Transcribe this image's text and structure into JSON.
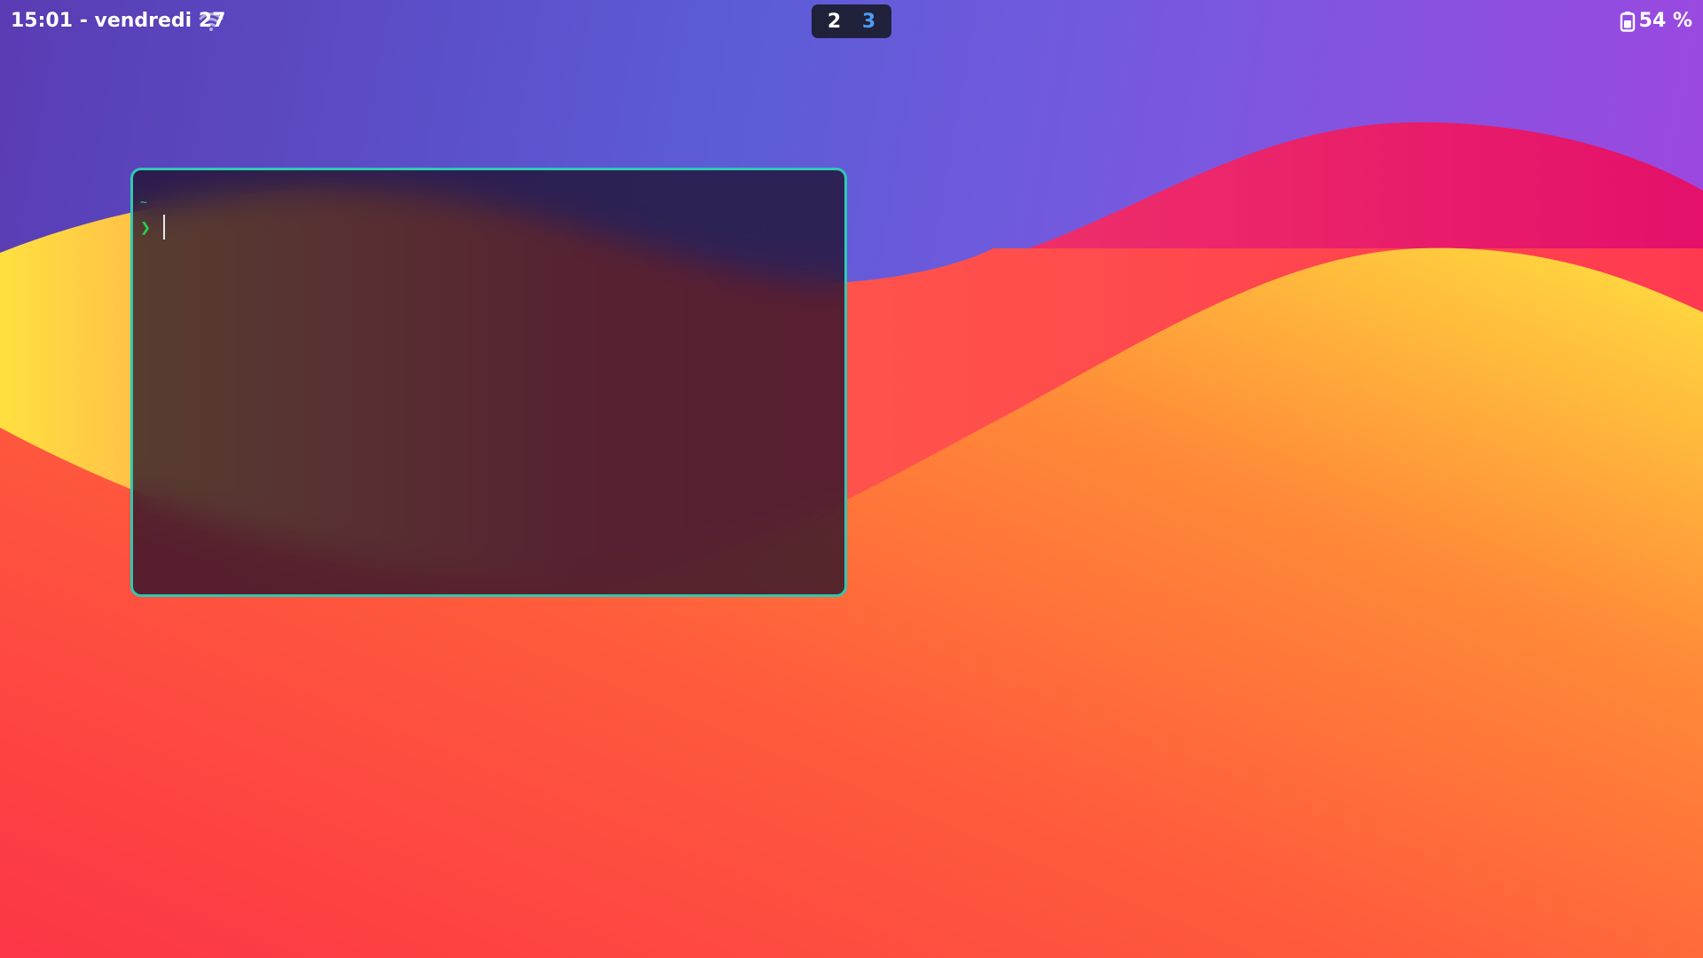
{
  "topbar": {
    "clock": "15:01 - vendredi 27",
    "wifi_icon": "wifi-icon",
    "workspaces": [
      {
        "label": "2",
        "active": false
      },
      {
        "label": "3",
        "active": true
      }
    ],
    "battery_icon": "battery-icon",
    "battery_label": "54 %"
  },
  "terminal": {
    "path": "~",
    "prompt_symbol": "❯",
    "border_color": "#2ec9b4"
  },
  "colors": {
    "workspace_active": "#4c9cf2",
    "prompt_green": "#27d04a"
  }
}
